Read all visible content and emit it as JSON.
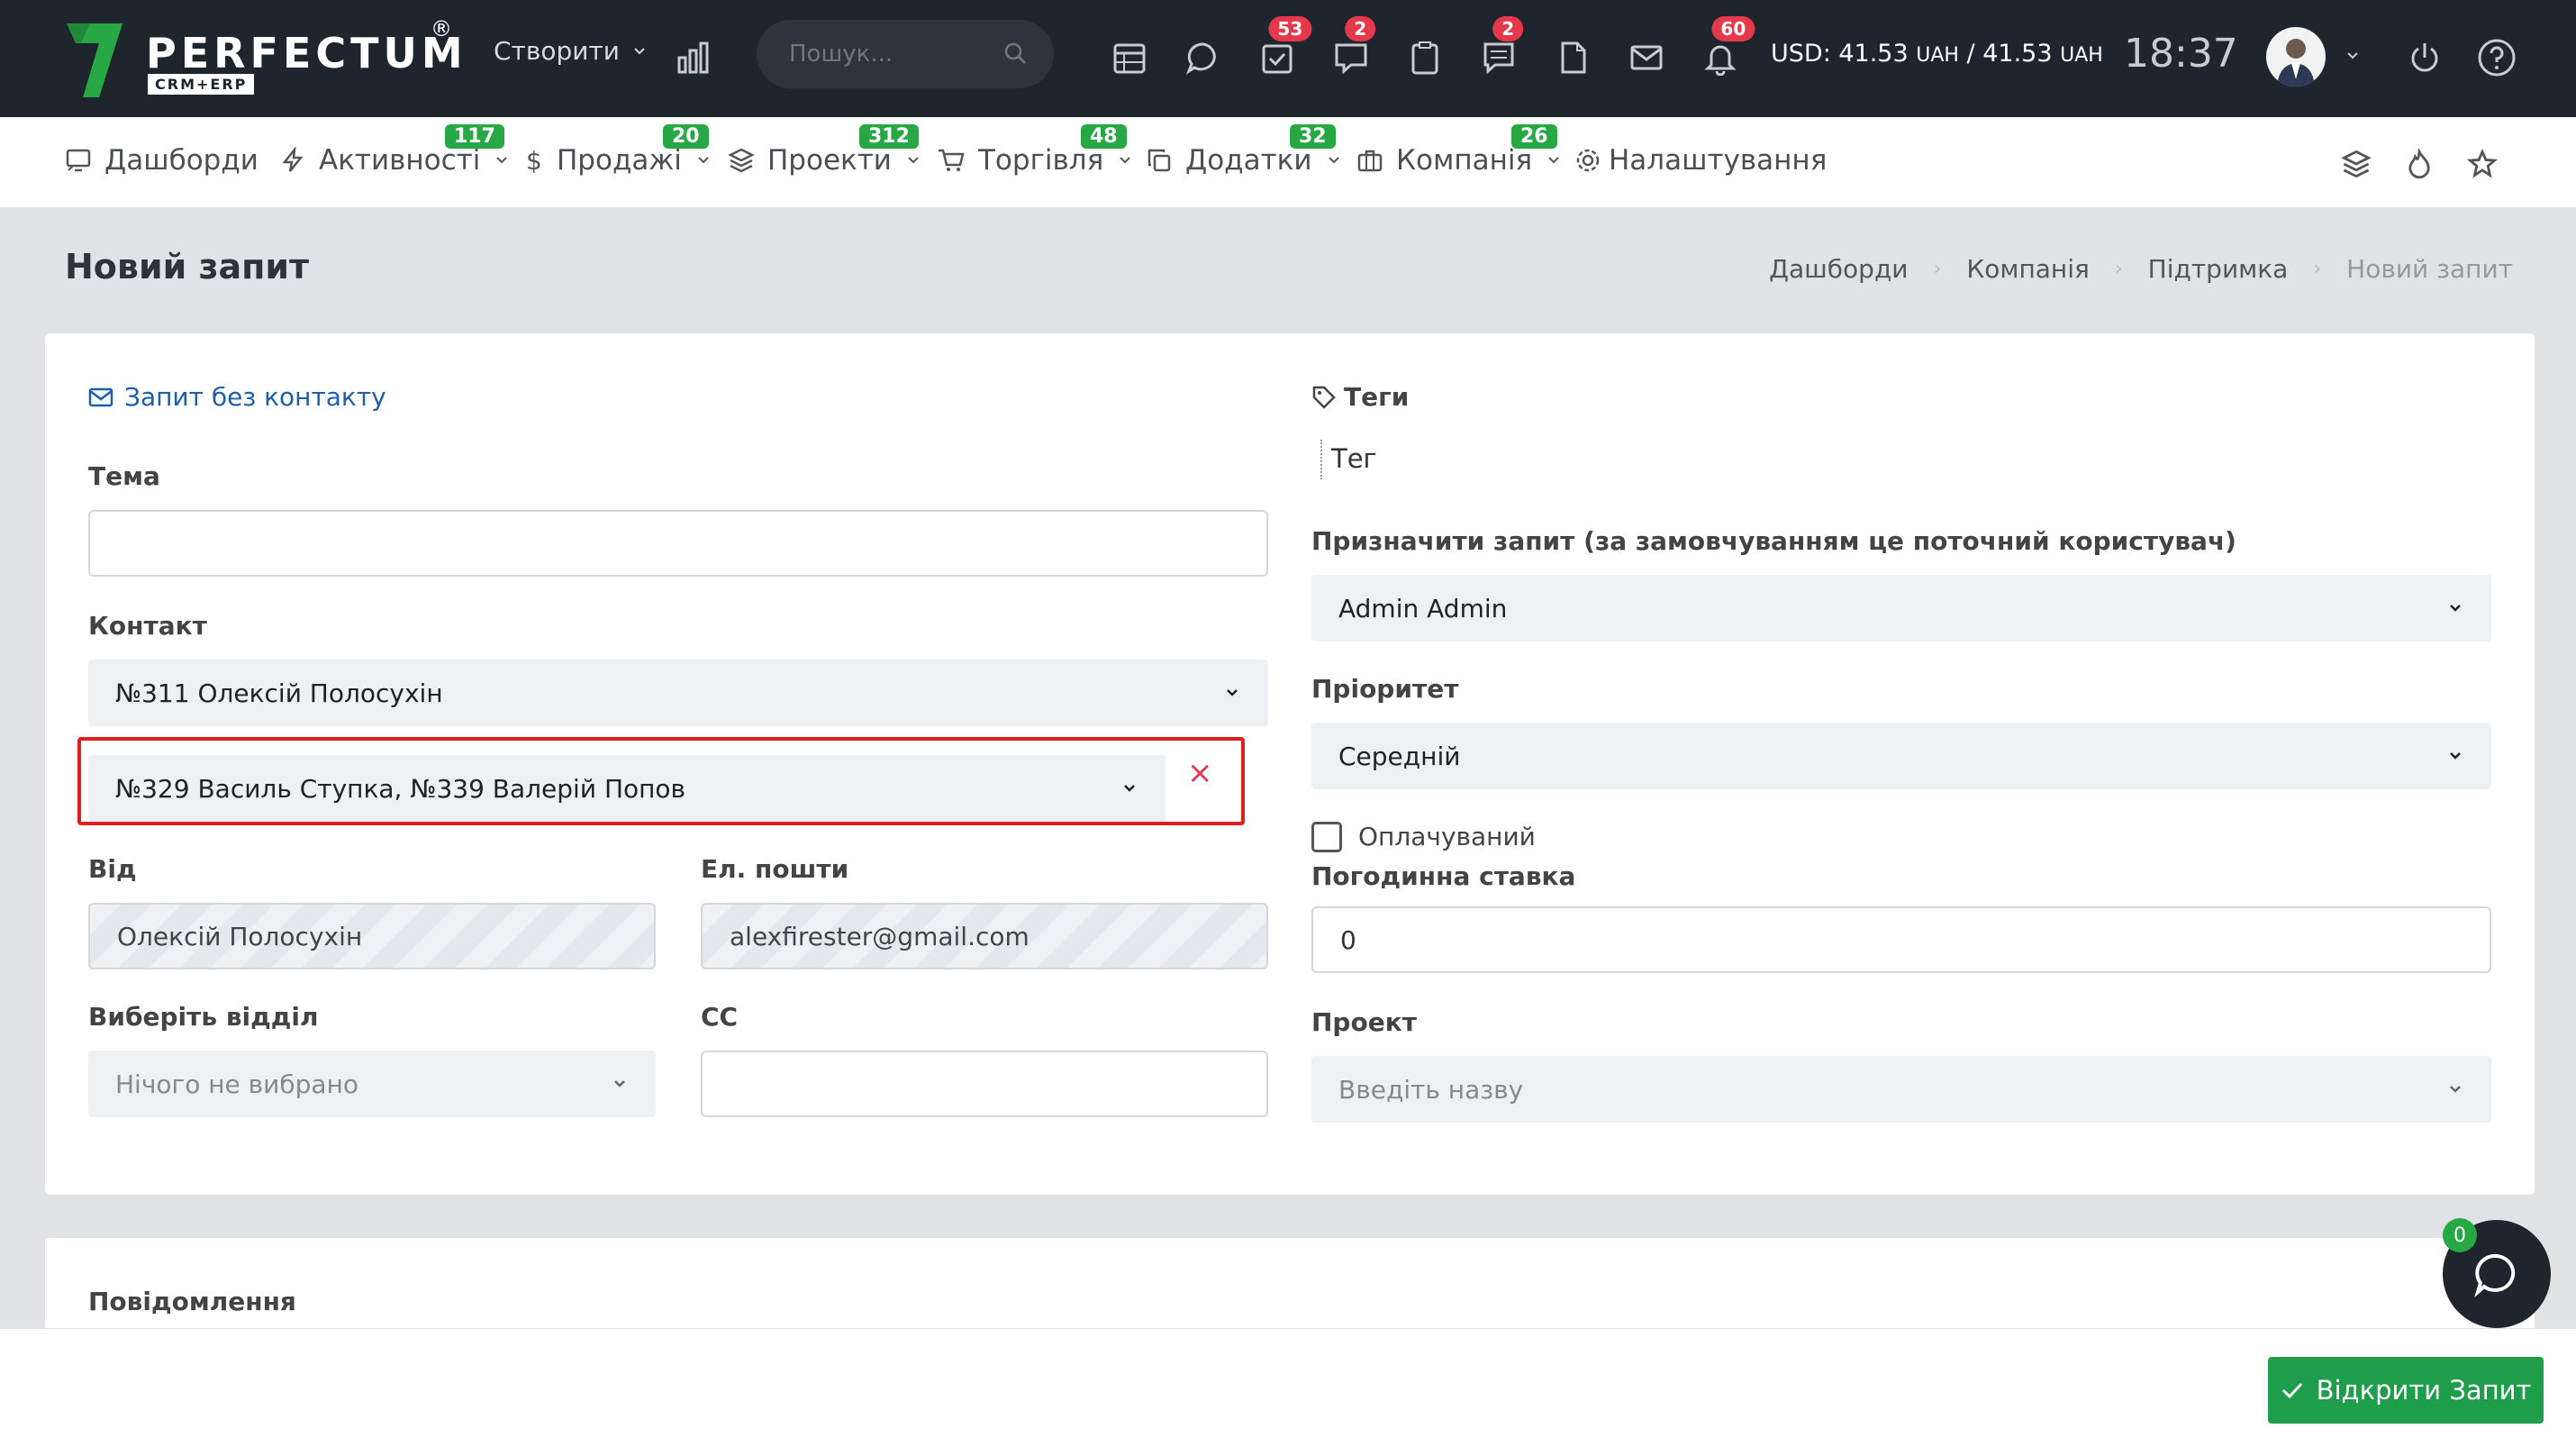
{
  "topbar": {
    "logo_text": "PERFECTUM",
    "logo_reg": "®",
    "logo_sub": "CRM+ERP",
    "create_label": "Створити",
    "search_placeholder": "Пошук...",
    "badges": {
      "tasks": "53",
      "chat": "2",
      "notes": "2",
      "notifications": "60"
    },
    "currency": "USD: 41.53",
    "currency_unit1": "UAH",
    "currency_sep": " / 41.53 ",
    "currency_unit2": "UAH",
    "time": "18:37"
  },
  "nav": {
    "items": [
      {
        "label": "Дашборди"
      },
      {
        "label": "Активності",
        "badge": "117"
      },
      {
        "label": "Продажі",
        "badge": "20"
      },
      {
        "label": "Проекти",
        "badge": "312"
      },
      {
        "label": "Торгівля",
        "badge": "48"
      },
      {
        "label": "Додатки",
        "badge": "32"
      },
      {
        "label": "Компанія",
        "badge": "26"
      },
      {
        "label": "Налаштування"
      }
    ]
  },
  "page": {
    "title": "Новий запит",
    "breadcrumbs": [
      "Дашборди",
      "Компанія",
      "Підтримка",
      "Новий запит"
    ]
  },
  "form": {
    "no_contact_link": "Запит без контакту",
    "subject_label": "Тема",
    "subject_value": "",
    "contact_label": "Контакт",
    "contact_value": "№311 Олексій Полосухін",
    "extra_contacts_value": "№329 Василь Ступка, №339 Валерій Попов",
    "from_label": "Від",
    "from_value": "Олексій Полосухін",
    "email_label": "Ел. пошти",
    "email_value": "alexfirester@gmail.com",
    "department_label": "Виберіть відділ",
    "department_value": "Нічого не вибрано",
    "cc_label": "CC",
    "cc_value": "",
    "tags_label": "Теги",
    "tag_placeholder": "Тег",
    "assign_label": "Призначити запит (за замовчуванням це поточний користувач)",
    "assign_value": "Admin Admin",
    "priority_label": "Пріоритет",
    "priority_value": "Середній",
    "billable_label": "Оплачуваний",
    "billable_checked": false,
    "rate_label": "Погодинна ставка",
    "rate_value": "0",
    "project_label": "Проект",
    "project_placeholder": "Введіть назву",
    "message_label": "Повідомлення"
  },
  "footer": {
    "submit_label": "Відкрити Запит",
    "chat_badge": "0"
  },
  "colors": {
    "topbar": "#1f252c",
    "accent_green": "#28a745",
    "badge_red": "#e5394b",
    "link_blue": "#1f5fa8",
    "highlight_red": "#e02020"
  }
}
